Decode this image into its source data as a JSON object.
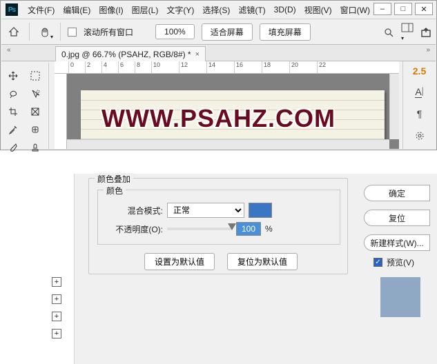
{
  "menu": {
    "items": [
      "文件(F)",
      "编辑(E)",
      "图像(I)",
      "图层(L)",
      "文字(Y)",
      "选择(S)",
      "滤镜(T)",
      "3D(D)",
      "视图(V)",
      "窗口(W)"
    ]
  },
  "window_buttons": {
    "min": "–",
    "max": "□",
    "close": "✕"
  },
  "options": {
    "scroll_all": "滚动所有窗口",
    "zoom": "100%",
    "fit": "适合屏幕",
    "fill": "填充屏幕"
  },
  "tab": {
    "title": "0.jpg @ 66.7% (PSAHZ, RGB/8#) *",
    "close": "×"
  },
  "ruler_ticks": [
    "0",
    "2",
    "4",
    "6",
    "8",
    "10",
    "12",
    "14",
    "16",
    "18",
    "20",
    "22"
  ],
  "canvas_text": "WWW.PSAHZ.COM",
  "right_panel": {
    "char_size": "2.5"
  },
  "dialog": {
    "group_title": "颜色叠加",
    "subgroup_title": "颜色",
    "blend_label": "混合模式:",
    "blend_value": "正常",
    "opacity_label": "不透明度(O):",
    "opacity_value": "100",
    "pct": "%",
    "set_default": "设置为默认值",
    "reset_default": "复位为默认值",
    "ok": "确定",
    "reset": "复位",
    "new_style": "新建样式(W)...",
    "preview": "预览(V)"
  },
  "colors": {
    "swatch": "#3a76c4",
    "preview": "#8fa9c4"
  }
}
